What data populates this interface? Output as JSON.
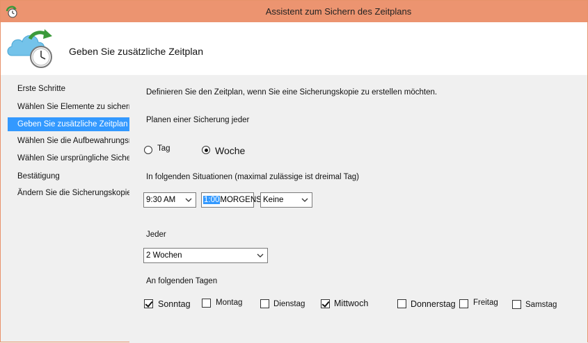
{
  "window": {
    "title": "Assistent zum Sichern des Zeitplans",
    "header_title": "Geben Sie zusätzliche Zeitplan",
    "accent": "#ec9470",
    "selection_color": "#3399ff"
  },
  "nav": {
    "items": [
      {
        "label": "Erste Schritte",
        "selected": false
      },
      {
        "label": "Wählen Sie Elemente zu sichern",
        "selected": false
      },
      {
        "label": "Geben Sie zusätzliche Zeitplan",
        "selected": true
      },
      {
        "label": "Wählen Sie die Aufbewahrungsrichtlinie",
        "selected": false
      },
      {
        "label": "Wählen Sie ursprüngliche Sicherung Typ aus.",
        "selected": false
      },
      {
        "label": "Bestätigung",
        "selected": false
      },
      {
        "label": "Ändern Sie die Sicherungskopie des Vorgangsfortschritts",
        "selected": false
      }
    ]
  },
  "form": {
    "intro": "Definieren Sie den Zeitplan, wenn Sie eine Sicherungskopie zu erstellen möchten.",
    "plan_label": "Planen einer Sicherung jeder",
    "radio_day": "Tag",
    "radio_week": "Woche",
    "radio_selected": "week",
    "situations_label": "In folgenden Situationen (maximal zulässige ist dreimal Tag)",
    "time1": "9:30 AM",
    "time2_hl": "1:00",
    "time2_rest": "MORGENS",
    "time3": "Keine",
    "every_label": "Jeder",
    "every_value": "2 Wochen",
    "days_label": "An folgenden Tagen",
    "days": [
      {
        "label": "Sonntag",
        "checked": true
      },
      {
        "label": "Montag",
        "checked": false
      },
      {
        "label": "Dienstag",
        "checked": false
      },
      {
        "label": "Mittwoch",
        "checked": true
      },
      {
        "label": "Donnerstag",
        "checked": false
      },
      {
        "label": "Freitag",
        "checked": false
      },
      {
        "label": "Samstag",
        "checked": false
      }
    ]
  },
  "icons": {
    "title": "clock-backup-icon",
    "header": "cloud-clock-icon",
    "dropdown": "chevron-down-icon"
  }
}
